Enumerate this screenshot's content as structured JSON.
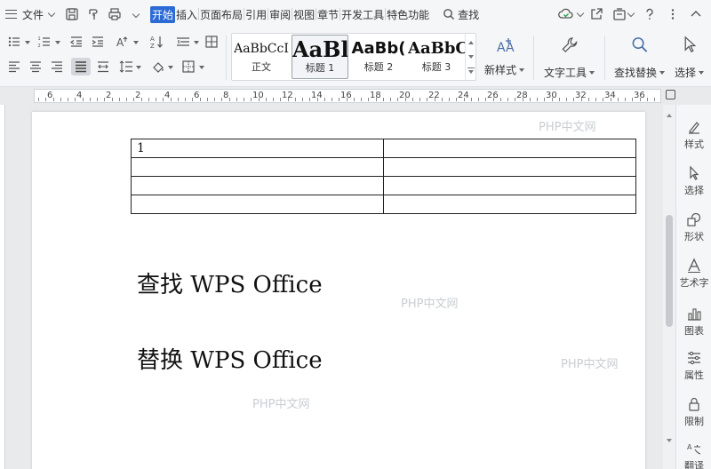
{
  "menubar": {
    "file_label": "文件",
    "tabs": [
      "开始",
      "插入",
      "页面布局",
      "引用",
      "审阅",
      "视图",
      "章节",
      "开发工具",
      "特色功能"
    ],
    "active_tab": "开始",
    "search_label": "查找"
  },
  "ribbon": {
    "styles": [
      {
        "sample": "AaBbCcI",
        "name": "正文"
      },
      {
        "sample": "AaBl",
        "name": "标题 1"
      },
      {
        "sample": "AaBb(",
        "name": "标题 2"
      },
      {
        "sample": "AaBbC",
        "name": "标题 3"
      }
    ],
    "selected_style": "标题 1",
    "new_style_label": "新样式",
    "text_tools_label": "文字工具",
    "find_replace_label": "查找替换",
    "select_label": "选择"
  },
  "ruler": {
    "labels": [
      "6",
      "4",
      "2",
      "2",
      "4",
      "6",
      "8",
      "10",
      "12",
      "14",
      "16",
      "18",
      "20",
      "22",
      "24",
      "26",
      "28",
      "30",
      "32",
      "34",
      "36"
    ]
  },
  "document": {
    "table": [
      [
        "1",
        ""
      ],
      [
        "",
        ""
      ],
      [
        "",
        ""
      ],
      [
        "",
        ""
      ]
    ],
    "line1": "查找 WPS Office",
    "line2": "替换 WPS Office"
  },
  "watermarks": [
    "PHP中文网",
    "PHP中文网",
    "PHP中文网",
    "PHP中文网"
  ],
  "sidebar": {
    "items": [
      "样式",
      "选择",
      "形状",
      "艺术字",
      "图表",
      "属性",
      "限制",
      "翻译"
    ]
  },
  "colors": {
    "accent": "#2c6ad6",
    "menubar_bg": "#f5f6f7",
    "workspace_bg": "#e9eaec"
  }
}
